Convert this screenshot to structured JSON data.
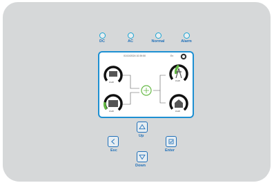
{
  "indicators": [
    {
      "label": "DC"
    },
    {
      "label": "AC"
    },
    {
      "label": "Normal"
    },
    {
      "label": "Alarm"
    }
  ],
  "screen": {
    "datetime": "01/10/2024 10:39:50",
    "language": "En",
    "gauges": {
      "pv": {
        "icon": "solar-panel-icon",
        "value": "0 kW"
      },
      "grid": {
        "icon": "power-tower-icon",
        "value": "0 kW"
      },
      "battery": {
        "icon": "battery-icon",
        "value": "0 kW"
      },
      "load": {
        "icon": "house-icon",
        "value": "0 kW"
      }
    }
  },
  "buttons": {
    "up": {
      "label": "Up",
      "icon": "triangle-up-icon"
    },
    "down": {
      "label": "Down",
      "icon": "triangle-down-icon"
    },
    "esc": {
      "label": "Esc",
      "icon": "chevron-left-icon"
    },
    "enter": {
      "label": "Enter",
      "icon": "checkbox-icon"
    }
  },
  "colors": {
    "accent": "#1f6fb8",
    "led_ring": "#1aa4d4",
    "screen_border": "#1c8fd2",
    "gauge_green": "#63b843",
    "panel": "#d6d8d9"
  }
}
